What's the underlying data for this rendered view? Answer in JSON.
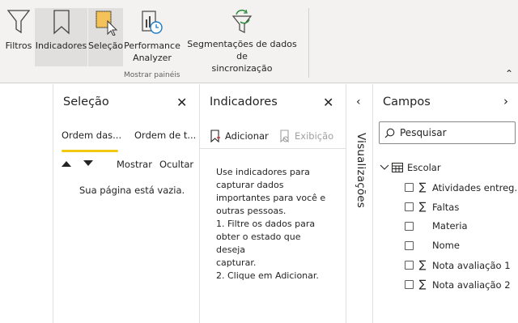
{
  "ribbon": {
    "buttons": [
      {
        "label": "Filtros",
        "icon": "funnel-icon"
      },
      {
        "label": "Indicadores",
        "icon": "bookmark-icon"
      },
      {
        "label": "Seleção",
        "icon": "selection-pointer-icon"
      },
      {
        "label_line1": "Performance",
        "label_line2": "Analyzer",
        "icon": "performance-stopwatch-icon"
      },
      {
        "label_line1": "Segmentações de dados de",
        "label_line2": "sincronização",
        "icon": "sync-slicers-icon"
      }
    ],
    "group_label": "Mostrar painéis",
    "collapse_glyph": "⌃"
  },
  "selecao": {
    "title": "Seleção",
    "tab_active": "Ordem das...",
    "tab_other": "Ordem de t...",
    "show_label": "Mostrar",
    "hide_label": "Ocultar",
    "empty_message": "Sua página está vazia."
  },
  "indicadores": {
    "title": "Indicadores",
    "add_label": "Adicionar",
    "view_label": "Exibição",
    "help_lines": [
      "Use indicadores para",
      "capturar dados",
      "importantes para você e",
      "outras pessoas.",
      "1. Filtre os dados para",
      "obter o estado que deseja",
      "capturar.",
      "2. Clique em Adicionar."
    ]
  },
  "visualizacoes": {
    "title": "Visualizações"
  },
  "campos": {
    "title": "Campos",
    "search_placeholder": "Pesquisar",
    "table_name": "Escolar",
    "fields": [
      {
        "name": "Atividades entreg...",
        "sigma": true
      },
      {
        "name": "Faltas",
        "sigma": true
      },
      {
        "name": "Materia",
        "sigma": false
      },
      {
        "name": "Nome",
        "sigma": false
      },
      {
        "name": "Nota avaliação 1",
        "sigma": true
      },
      {
        "name": "Nota avaliação 2",
        "sigma": true
      }
    ]
  },
  "colors": {
    "accent_underline": "#f2c811",
    "ribbon_bg": "#f3f2f1",
    "active_btn": "#e1dfdd"
  }
}
